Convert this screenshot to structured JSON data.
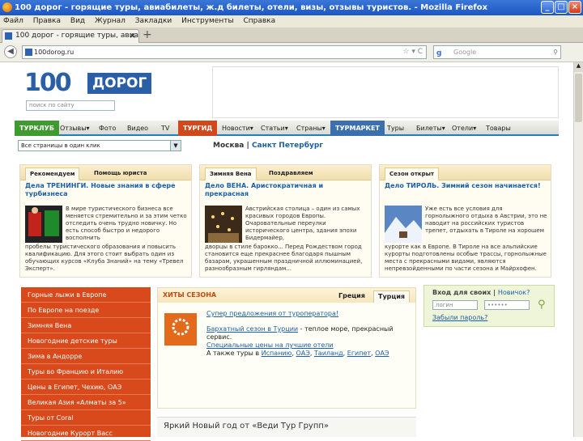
{
  "window": {
    "title": "100 дорог - горящие туры, авиабилеты, ж.д билеты, отели, визы, отзывы туристов. - Mozilla Firefox",
    "buttons": [
      "_",
      "□",
      "×"
    ]
  },
  "menubar": [
    "Файл",
    "Правка",
    "Вид",
    "Журнал",
    "Закладки",
    "Инструменты",
    "Справка"
  ],
  "tab": {
    "label": "100 дорог - горящие туры, авиабилеты,",
    "close": "×",
    "new": "+"
  },
  "nav": {
    "back": "◀",
    "url": "100dorog.ru",
    "url_ctrls": "☆ ▾ C",
    "search_engine": "g",
    "search_placeholder": "Google"
  },
  "site": {
    "logo_num": "100",
    "logo_word": "ДОРОГ",
    "search_placeholder": "поиск по сайту",
    "menu": [
      {
        "label": "ТУРКЛУБ",
        "kind": "section",
        "color": "#3f9a2f"
      },
      {
        "label": "Отзывы▾"
      },
      {
        "label": "Фото"
      },
      {
        "label": "Видео"
      },
      {
        "label": "TV"
      },
      {
        "label": "ТУРГИД",
        "kind": "section",
        "color": "#d0481b"
      },
      {
        "label": "Новости▾"
      },
      {
        "label": "Статьи▾"
      },
      {
        "label": "Страны▾"
      },
      {
        "label": "ТУРМАРКЕТ",
        "kind": "section",
        "color": "#3a6fb0"
      },
      {
        "label": "Туры"
      },
      {
        "label": "Билеты▾"
      },
      {
        "label": "Отели▾"
      },
      {
        "label": "Товары"
      }
    ],
    "city_select": "Все страницы в один клик",
    "cities": {
      "current": "Москва",
      "sep": "|",
      "other": "Санкт Петербург"
    }
  },
  "panels": [
    {
      "tabs": [
        "Рекомендуем",
        "Помощь юриста"
      ],
      "active": 0,
      "headline": "Дела ТРЕНИНГИ. Новые знания в сфере турбизнеса",
      "text1": "В мире туристического бизнеса все меняется стремительно и за этим четко отследить очень трудно новичку. Но есть способ быстро и недорого восполнить",
      "text2": "пробелы туристического образования и повысить квалификацию. Для этого стоит выбрать один из обучающих курсов «Клуба Знаний» на тему «Тревел Эксперт»."
    },
    {
      "tabs": [
        "Зимняя Вена",
        "Поздравляем"
      ],
      "active": 0,
      "headline": "Дело ВЕНА. Аристократичная и прекрасная",
      "text1": "Австрийская столица – один из самых красивых городов Европы. Очаровательные переулки исторического центра, здания эпохи Бидермайер,",
      "text2": "дворцы в стиле барокко... Перед Рождеством город становится еще прекраснее благодаря пышным базарам, украшенным праздничной иллюминацией, разнообразным гирляндам..."
    },
    {
      "tabs": [
        "Сезон открыт"
      ],
      "active": 0,
      "headline": "Дело ТИРОЛЬ. Зимний сезон начинается!",
      "text1": "Уже есть все условия для горнолыжного отдыха в Австрии, это не наводит на российских туристов трепет, отдыхать в Тироле на хорошем",
      "text2": "курорте как в Европе. В Тироле на все альпийские курорты подготовлены особые трассы, горнолыжные места с прекрасными видами, являются непревзойденными по части сезона и Майрхофен."
    }
  ],
  "sidenav": [
    "Горные лыжи в Европе",
    "По Европе на поезде",
    "Зимняя Вена",
    "Новогодние детские туры",
    "Зима в Андорре",
    "Туры во Францию и Италию",
    "Цены в Египет, Чехию, ОАЭ",
    "Великая Азия «Алматы за 5»",
    "Туры от Coral",
    "Новогодние Курорт Васс"
  ],
  "hits": {
    "title": "ХИТЫ СЕЗОНА",
    "tabs": [
      "Греция",
      "Турция"
    ],
    "active_tab": 1,
    "offer": "Супер предложения от туроператора!",
    "logo_text": "coral",
    "line1_link": "Бархатный сезон в Турции",
    "line1_text": " - теплое море, прекрасный сервис.",
    "line2_link": "Специальные цены на лучшие отели",
    "line3_text": "А также туры в ",
    "line3_links": [
      "Испанию",
      "ОАЭ",
      "Таиланд",
      "Египет",
      "ОАЭ"
    ]
  },
  "promo": "Яркий Новый год от «Веди Тур Групп»",
  "login": {
    "title": "Вход для своих",
    "register": "Новичок?",
    "login_placeholder": "логин",
    "password_value": "••••••",
    "forgot": "Забыли пароль?"
  }
}
